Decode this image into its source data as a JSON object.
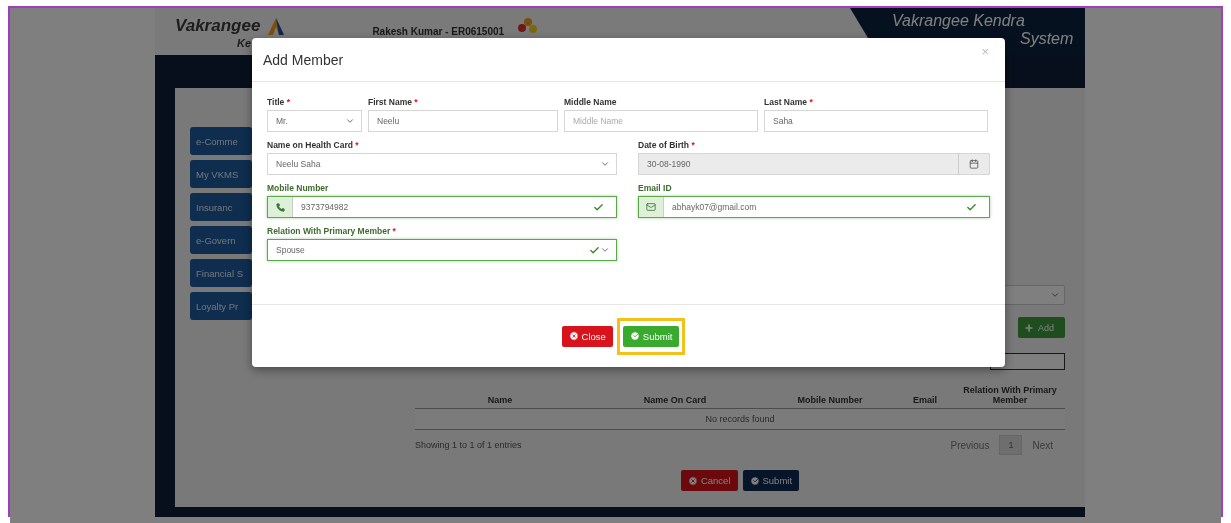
{
  "header": {
    "logo": "Vakrangee",
    "logo_sub": "Ke",
    "user": "Rakesh Kumar - ER0615001",
    "brand_line1": "Vakrangee Kendra",
    "brand_line2": "System"
  },
  "sidebar": {
    "items": [
      {
        "label": "e-Comme"
      },
      {
        "label": "My VKMS"
      },
      {
        "label": "Insuranc"
      },
      {
        "label": "e-Govern"
      },
      {
        "label": "Financial S"
      },
      {
        "label": "Loyalty Pr"
      }
    ]
  },
  "page": {
    "add_button": "Add",
    "table": {
      "columns": [
        "Name",
        "Name On Card",
        "Mobile Number",
        "Email",
        "Relation With Primary Member"
      ],
      "empty_text": "No records found"
    },
    "info": "Showing 1 to 1 of 1 entries",
    "pagination": {
      "previous": "Previous",
      "pages": [
        {
          "label": "1",
          "selected": true
        }
      ],
      "next": "Next"
    },
    "buttons": [
      {
        "label": "Cancel",
        "kind": "danger"
      },
      {
        "label": "Submit",
        "kind": "primary"
      }
    ]
  },
  "modal": {
    "title": "Add Member",
    "close": "×",
    "required_mark": "*",
    "rows": [
      {
        "fields": [
          {
            "label": "Title",
            "required": true,
            "kind": "select",
            "value": "Mr.",
            "valid": false,
            "disabled": false
          },
          {
            "label": "First Name",
            "required": true,
            "kind": "text",
            "value": "Neelu",
            "valid": false,
            "disabled": false
          },
          {
            "label": "Middle Name",
            "required": false,
            "kind": "text",
            "placeholder": "Middle Name",
            "valid": false,
            "disabled": false
          },
          {
            "label": "Last Name",
            "required": true,
            "kind": "text",
            "value": "Saha",
            "valid": false,
            "disabled": false
          }
        ]
      },
      {
        "fields": [
          {
            "label": "Name on Health Card",
            "required": true,
            "kind": "select",
            "value": "Neelu Saha",
            "valid": false,
            "disabled": false
          },
          {
            "label": "Date of Birth",
            "required": true,
            "kind": "date",
            "value": "30-08-1990",
            "valid": false,
            "disabled": true
          }
        ]
      },
      {
        "fields": [
          {
            "label": "Mobile Number",
            "required": false,
            "kind": "phone",
            "value": "9373794982",
            "valid": true,
            "disabled": false
          },
          {
            "label": "Email ID",
            "required": false,
            "kind": "email",
            "value": "abhayk07@gmail.com",
            "valid": true,
            "disabled": false
          }
        ]
      },
      {
        "fields": [
          {
            "label": "Relation With Primary Member",
            "required": true,
            "kind": "select",
            "value": "Spouse",
            "valid": true,
            "disabled": false
          }
        ]
      }
    ],
    "buttons": [
      {
        "label": "Close",
        "kind": "danger",
        "highlighted": false
      },
      {
        "label": "Submit",
        "kind": "success",
        "highlighted": true
      }
    ]
  }
}
